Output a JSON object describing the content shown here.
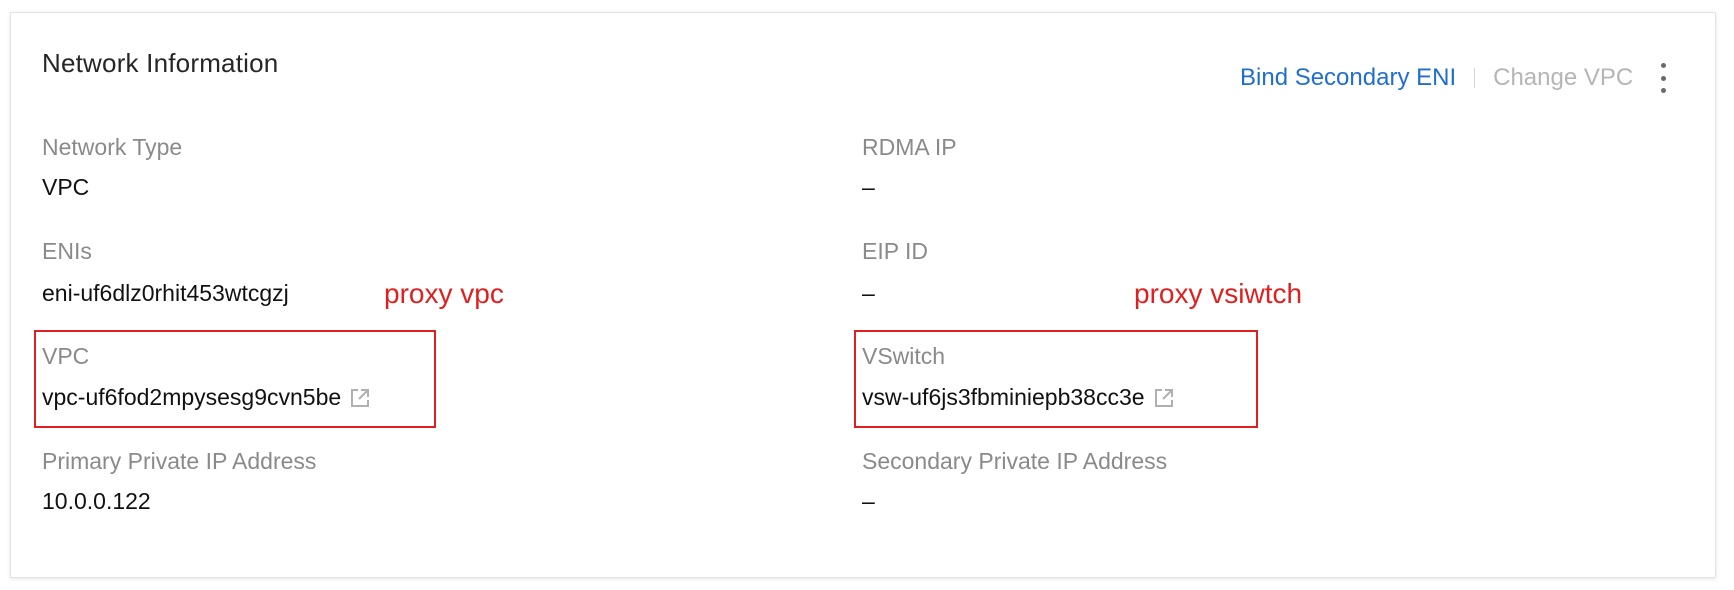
{
  "card": {
    "title": "Network Information",
    "actions": {
      "bind_secondary_eni": "Bind Secondary ENI",
      "change_vpc": "Change VPC",
      "more_icon": "vertical-ellipsis-icon"
    }
  },
  "fields": {
    "network_type": {
      "label": "Network Type",
      "value": "VPC"
    },
    "rdma_ip": {
      "label": "RDMA IP",
      "value": "–"
    },
    "enis": {
      "label": "ENIs",
      "value": "eni-uf6dlz0rhit453wtcgzj"
    },
    "eip_id": {
      "label": "EIP ID",
      "value": "–"
    },
    "vpc": {
      "label": "VPC",
      "value": "vpc-uf6fod2mpysesg9cvn5be",
      "icon": "external-link-icon"
    },
    "vswitch": {
      "label": "VSwitch",
      "value": "vsw-uf6js3fbminiepb38cc3e",
      "icon": "external-link-icon"
    },
    "primary_private_ip": {
      "label": "Primary Private IP Address",
      "value": "10.0.0.122"
    },
    "secondary_private_ip": {
      "label": "Secondary Private IP Address",
      "value": "–"
    }
  },
  "annotations": {
    "proxy_vpc": "proxy vpc",
    "proxy_vswitch": "proxy vsiwtch"
  },
  "colors": {
    "link_blue": "#1f6fd1",
    "disabled_gray": "#b5b5b5",
    "label_gray": "#8a8a8a",
    "annotation_red": "#e02020"
  }
}
